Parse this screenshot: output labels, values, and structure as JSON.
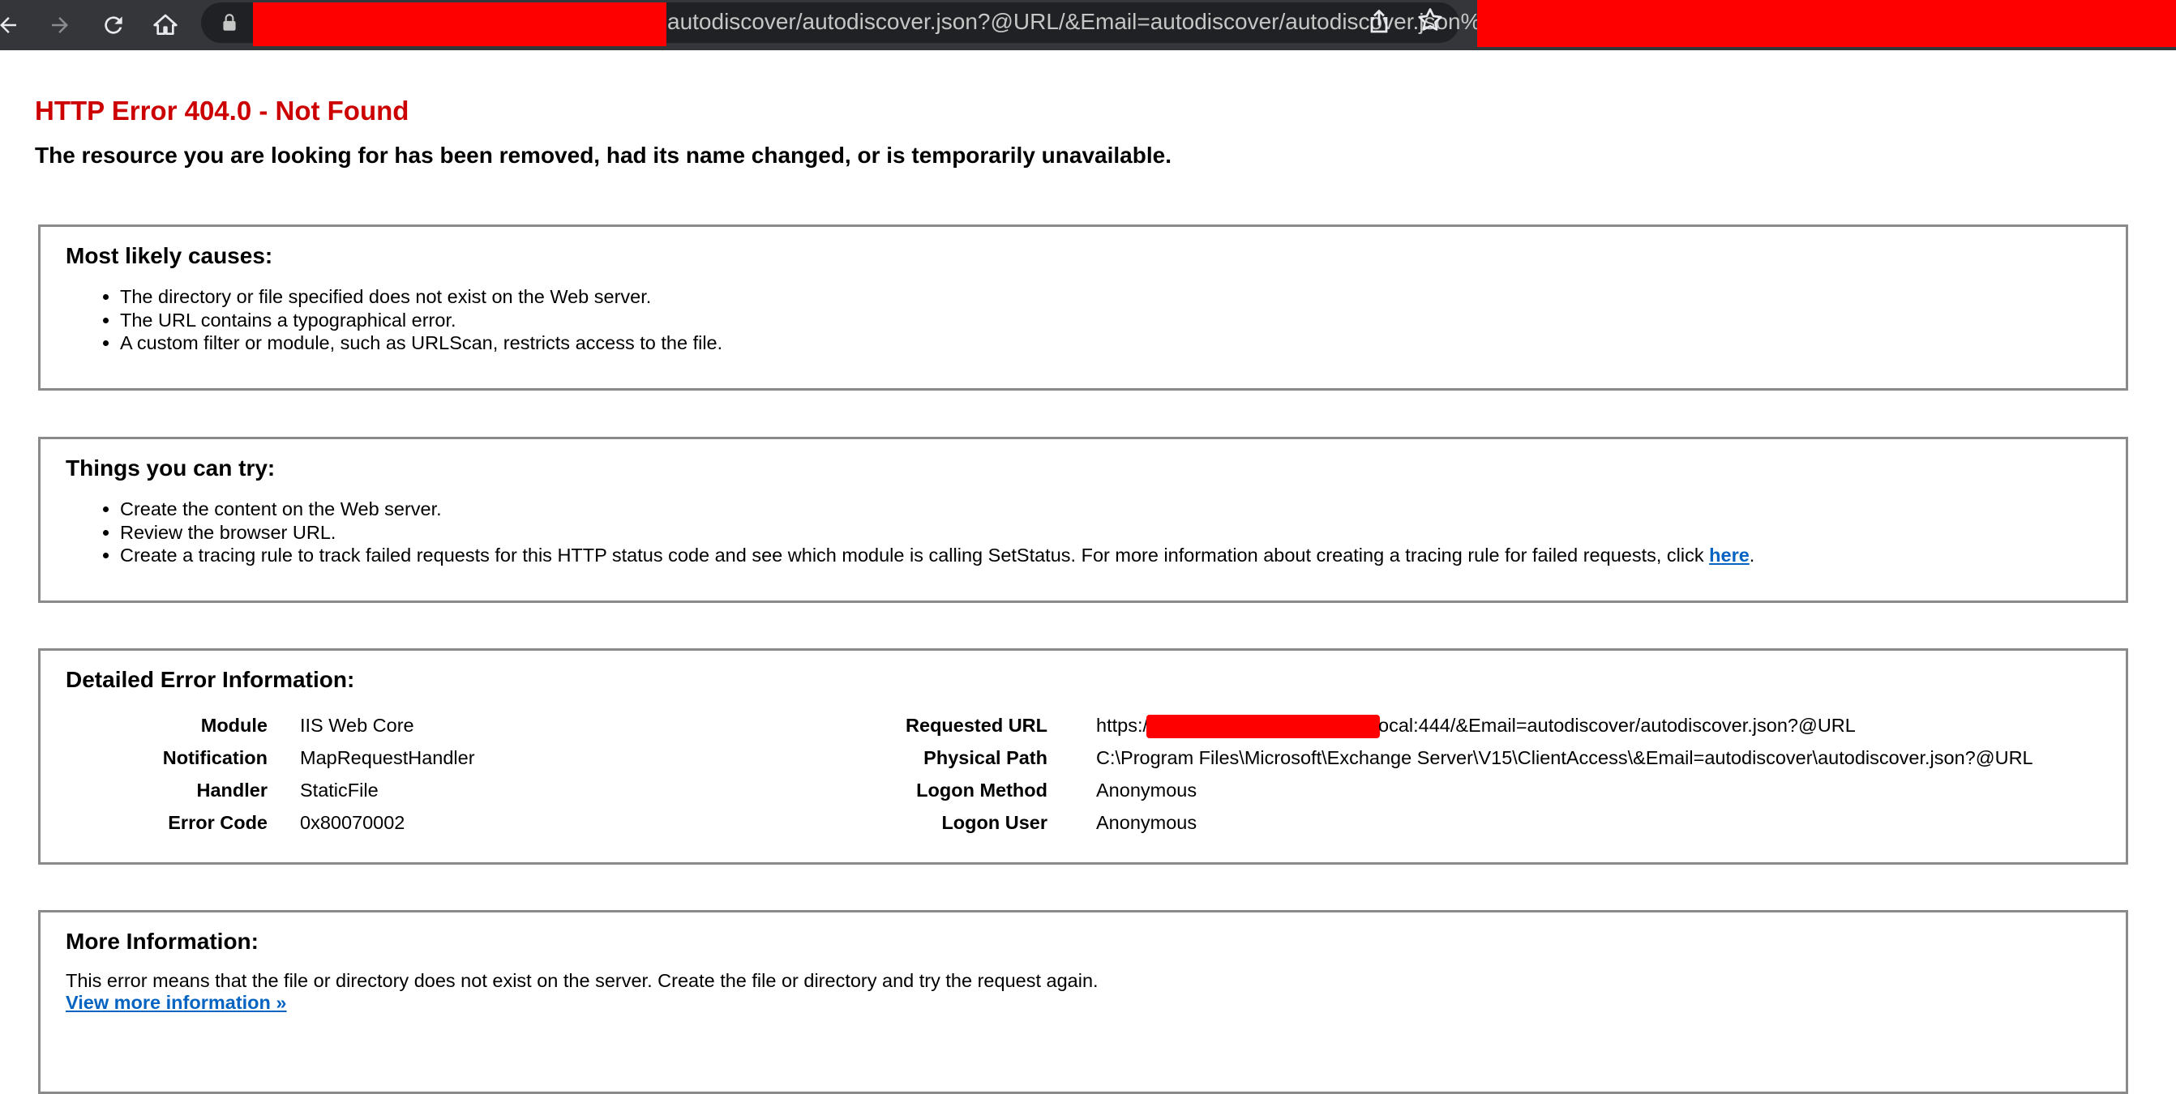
{
  "browser": {
    "url_text": "autodiscover/autodiscover.json?@URL/&Email=autodiscover/autodiscover.json%...",
    "icons": {
      "back": "arrow-left-icon",
      "forward": "arrow-right-icon",
      "reload": "reload-icon",
      "home": "home-icon",
      "lock": "lock-icon",
      "share": "share-icon",
      "bookmark": "star-icon"
    }
  },
  "page": {
    "title": "HTTP Error 404.0 - Not Found",
    "subtitle": "The resource you are looking for has been removed, had its name changed, or is temporarily unavailable."
  },
  "causes": {
    "heading": "Most likely causes:",
    "items": [
      "The directory or file specified does not exist on the Web server.",
      "The URL contains a typographical error.",
      "A custom filter or module, such as URLScan, restricts access to the file."
    ]
  },
  "try": {
    "heading": "Things you can try:",
    "items": [
      "Create the content on the Web server.",
      "Review the browser URL.",
      "Create a tracing rule to track failed requests for this HTTP status code and see which module is calling SetStatus. For more information about creating a tracing rule for failed requests, click "
    ],
    "link": "here",
    "after_link": "."
  },
  "details": {
    "heading": "Detailed Error Information:",
    "left": [
      {
        "label": "Module",
        "value": "IIS Web Core"
      },
      {
        "label": "Notification",
        "value": "MapRequestHandler"
      },
      {
        "label": "Handler",
        "value": "StaticFile"
      },
      {
        "label": "Error Code",
        "value": "0x80070002"
      }
    ],
    "right": [
      {
        "label": "Requested URL",
        "value_prefix": "https:/",
        "value_suffix": "ocal:444/&Email=autodiscover/autodiscover.json?@URL"
      },
      {
        "label": "Physical Path",
        "value": "C:\\Program Files\\Microsoft\\Exchange Server\\V15\\ClientAccess\\&Email=autodiscover\\autodiscover.json?@URL"
      },
      {
        "label": "Logon Method",
        "value": "Anonymous"
      },
      {
        "label": "Logon User",
        "value": "Anonymous"
      }
    ]
  },
  "more": {
    "heading": "More Information:",
    "text": "This error means that the file or directory does not exist on the server. Create the file or directory and try the request again.",
    "link": "View more information »"
  },
  "colors": {
    "title_red": "#cc0000",
    "link_blue": "#0563c1",
    "redaction": "#ff0000",
    "chrome_bg": "#35363a"
  }
}
